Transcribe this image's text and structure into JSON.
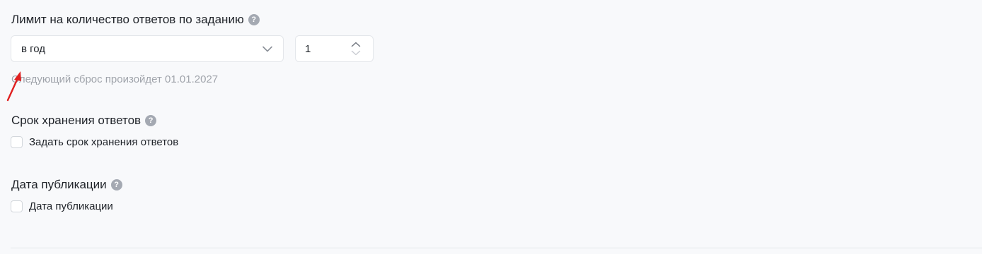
{
  "answer_limit": {
    "title": "Лимит на количество ответов по заданию",
    "help_icon": "?",
    "period_select": {
      "value": "в год"
    },
    "count_input": {
      "value": "1"
    },
    "next_reset_hint": "Следующий сброс произойдет 01.01.2027"
  },
  "retention": {
    "title": "Срок хранения ответов",
    "help_icon": "?",
    "checkbox_label": "Задать срок хранения ответов",
    "checked": false
  },
  "publication_date": {
    "title": "Дата публикации",
    "help_icon": "?",
    "checkbox_label": "Дата публикации",
    "checked": false
  },
  "colors": {
    "background": "#f8f9fb",
    "help_icon": "#a4a9b2",
    "hint_text": "#a0a4ab",
    "annotation_arrow": "#e02020"
  }
}
